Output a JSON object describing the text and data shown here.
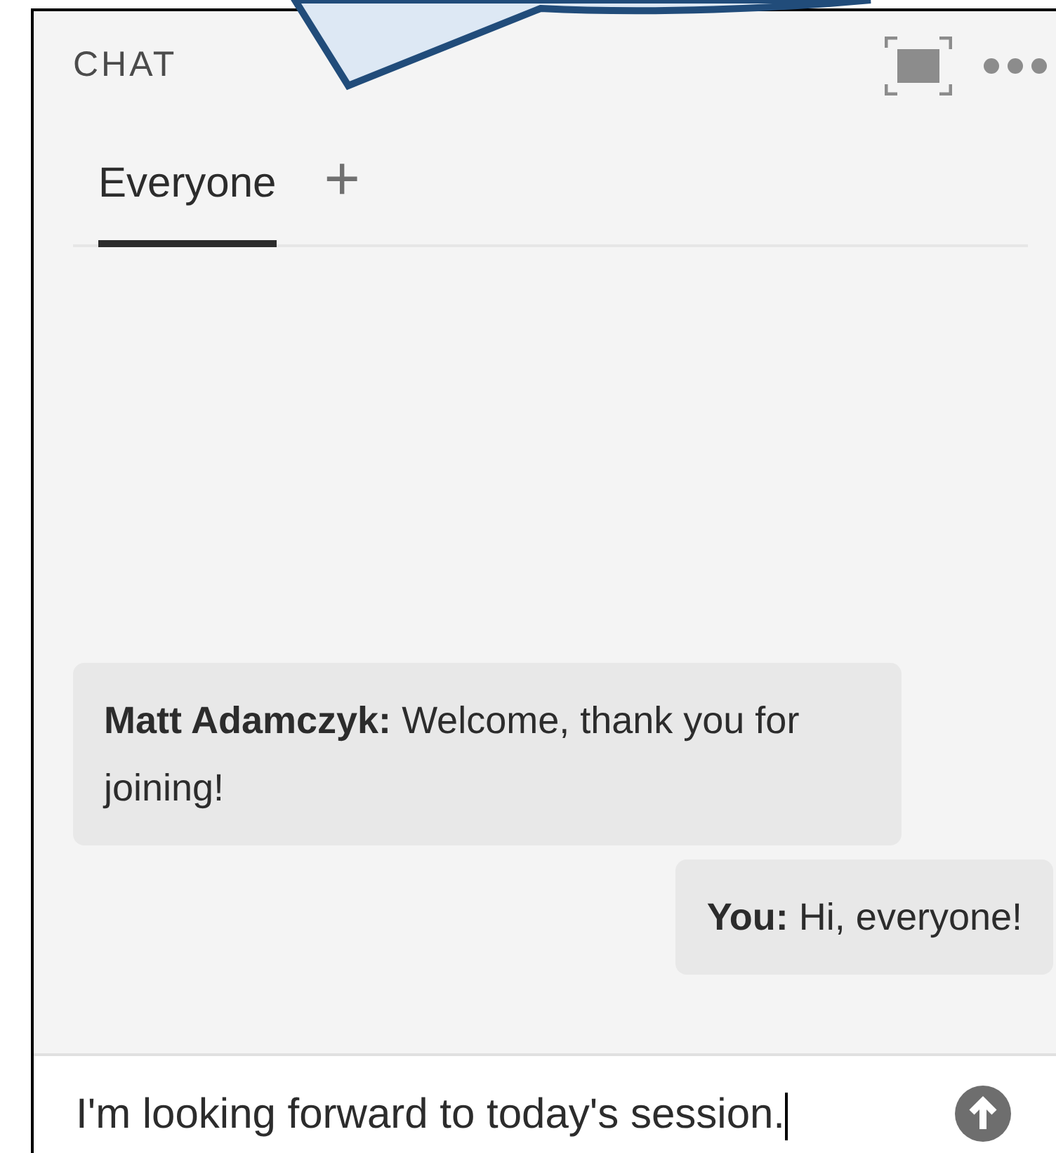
{
  "header": {
    "title": "CHAT"
  },
  "tabs": [
    {
      "label": "Everyone",
      "selected": true
    }
  ],
  "add_tab": {
    "label": "+"
  },
  "messages": [
    {
      "sender": "Matt Adamczyk:",
      "text": "Welcome, thank you for joining!",
      "mine": false
    },
    {
      "sender": "You:",
      "text": "Hi, everyone!",
      "mine": true
    }
  ],
  "composer": {
    "value": "I'm looking forward to today's session."
  }
}
